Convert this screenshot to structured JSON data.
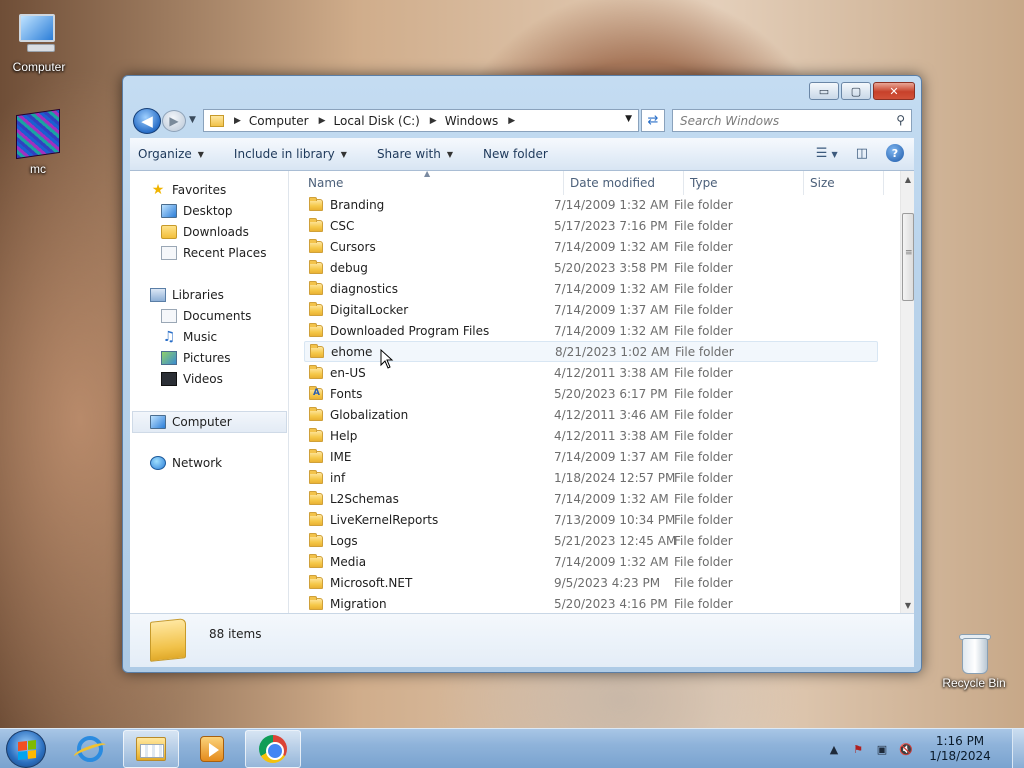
{
  "desktop": {
    "icons": [
      {
        "label": "Computer"
      },
      {
        "label": "mc"
      },
      {
        "label": "Recycle Bin"
      }
    ]
  },
  "window": {
    "caption": {
      "minimize": "▭",
      "maximize": "▢",
      "close": "✕"
    },
    "address": {
      "crumbs": [
        "Computer",
        "Local Disk (C:)",
        "Windows"
      ]
    },
    "search_placeholder": "Search Windows",
    "toolbar": {
      "organize": "Organize",
      "include_in_library": "Include in library",
      "share_with": "Share with",
      "new_folder": "New folder"
    },
    "navpane": {
      "favorites": "Favorites",
      "desktop": "Desktop",
      "downloads": "Downloads",
      "recent_places": "Recent Places",
      "libraries": "Libraries",
      "documents": "Documents",
      "music": "Music",
      "pictures": "Pictures",
      "videos": "Videos",
      "computer": "Computer",
      "network": "Network"
    },
    "columns": {
      "name": "Name",
      "date_modified": "Date modified",
      "type": "Type",
      "size": "Size"
    },
    "rows": [
      {
        "name": "Branding",
        "date": "7/14/2009 1:32 AM",
        "type": "File folder"
      },
      {
        "name": "CSC",
        "date": "5/17/2023 7:16 PM",
        "type": "File folder"
      },
      {
        "name": "Cursors",
        "date": "7/14/2009 1:32 AM",
        "type": "File folder"
      },
      {
        "name": "debug",
        "date": "5/20/2023 3:58 PM",
        "type": "File folder"
      },
      {
        "name": "diagnostics",
        "date": "7/14/2009 1:32 AM",
        "type": "File folder"
      },
      {
        "name": "DigitalLocker",
        "date": "7/14/2009 1:37 AM",
        "type": "File folder"
      },
      {
        "name": "Downloaded Program Files",
        "date": "7/14/2009 1:32 AM",
        "type": "File folder"
      },
      {
        "name": "ehome",
        "date": "8/21/2023 1:02 AM",
        "type": "File folder"
      },
      {
        "name": "en-US",
        "date": "4/12/2011 3:38 AM",
        "type": "File folder"
      },
      {
        "name": "Fonts",
        "date": "5/20/2023 6:17 PM",
        "type": "File folder"
      },
      {
        "name": "Globalization",
        "date": "4/12/2011 3:46 AM",
        "type": "File folder"
      },
      {
        "name": "Help",
        "date": "4/12/2011 3:38 AM",
        "type": "File folder"
      },
      {
        "name": "IME",
        "date": "7/14/2009 1:37 AM",
        "type": "File folder"
      },
      {
        "name": "inf",
        "date": "1/18/2024 12:57 PM",
        "type": "File folder"
      },
      {
        "name": "L2Schemas",
        "date": "7/14/2009 1:32 AM",
        "type": "File folder"
      },
      {
        "name": "LiveKernelReports",
        "date": "7/13/2009 10:34 PM",
        "type": "File folder"
      },
      {
        "name": "Logs",
        "date": "5/21/2023 12:45 AM",
        "type": "File folder"
      },
      {
        "name": "Media",
        "date": "7/14/2009 1:32 AM",
        "type": "File folder"
      },
      {
        "name": "Microsoft.NET",
        "date": "9/5/2023 4:23 PM",
        "type": "File folder"
      },
      {
        "name": "Migration",
        "date": "5/20/2023 4:16 PM",
        "type": "File folder"
      }
    ],
    "details": {
      "item_count": "88 items"
    }
  },
  "taskbar": {
    "clock_time": "1:16 PM",
    "clock_date": "1/18/2024"
  }
}
